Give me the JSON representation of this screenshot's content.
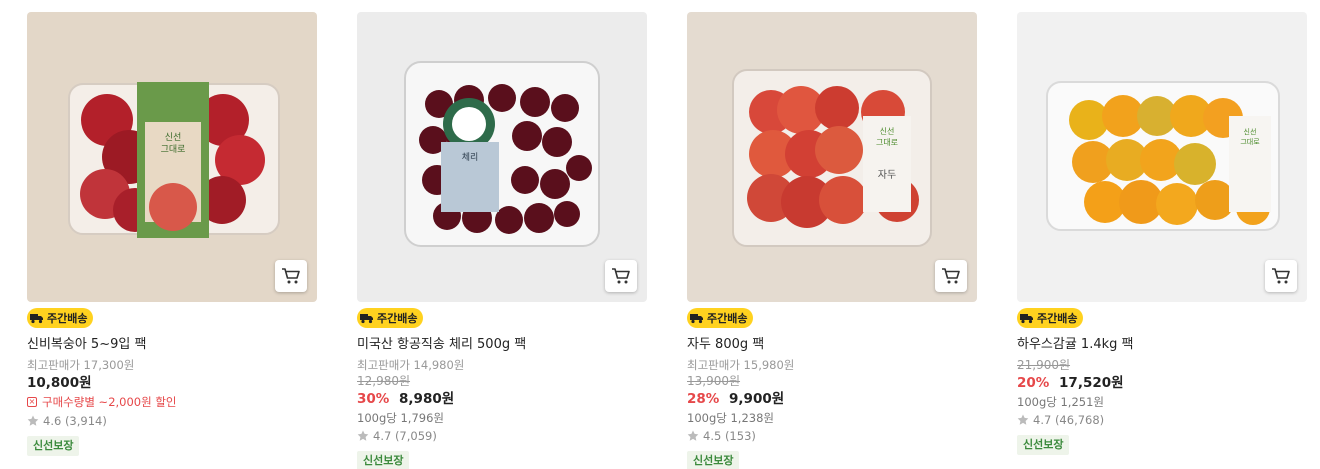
{
  "products": [
    {
      "badge": "주간배송",
      "name": "신비복숭아 5~9입 팩",
      "ref_price": "최고판매가 17,300원",
      "price": "10,800원",
      "coupon": "구매수량별 ~2,000원 할인",
      "rating": "4.6 (3,914)",
      "fresh": "신선보장",
      "fruit_color": "#b3202a",
      "bg_color": "#e3d7c8"
    },
    {
      "badge": "주간배송",
      "name": "미국산 항공직송 체리 500g 팩",
      "ref_price": "최고판매가 14,980원",
      "orig_price": "12,980원",
      "discount": "30%",
      "price": "8,980원",
      "unit_price": "100g당 1,796원",
      "rating": "4.7 (7,059)",
      "fresh": "신선보장",
      "fruit_color": "#5a0f1c",
      "bg_color": "#ececec"
    },
    {
      "badge": "주간배송",
      "name": "자두 800g 팩",
      "ref_price": "최고판매가 15,980원",
      "orig_price": "13,900원",
      "discount": "28%",
      "price": "9,900원",
      "unit_price": "100g당 1,238원",
      "rating": "4.5 (153)",
      "fresh": "신선보장",
      "fruit_color": "#d8483a",
      "bg_color": "#e4dbd0"
    },
    {
      "badge": "주간배송",
      "name": "하우스감귤 1.4kg 팩",
      "orig_price": "21,900원",
      "discount": "20%",
      "price": "17,520원",
      "unit_price": "100g당 1,251원",
      "rating": "4.7 (46,768)",
      "fresh": "신선보장",
      "fruit_color": "#f2a21c",
      "bg_color": "#f1f1f1"
    }
  ]
}
